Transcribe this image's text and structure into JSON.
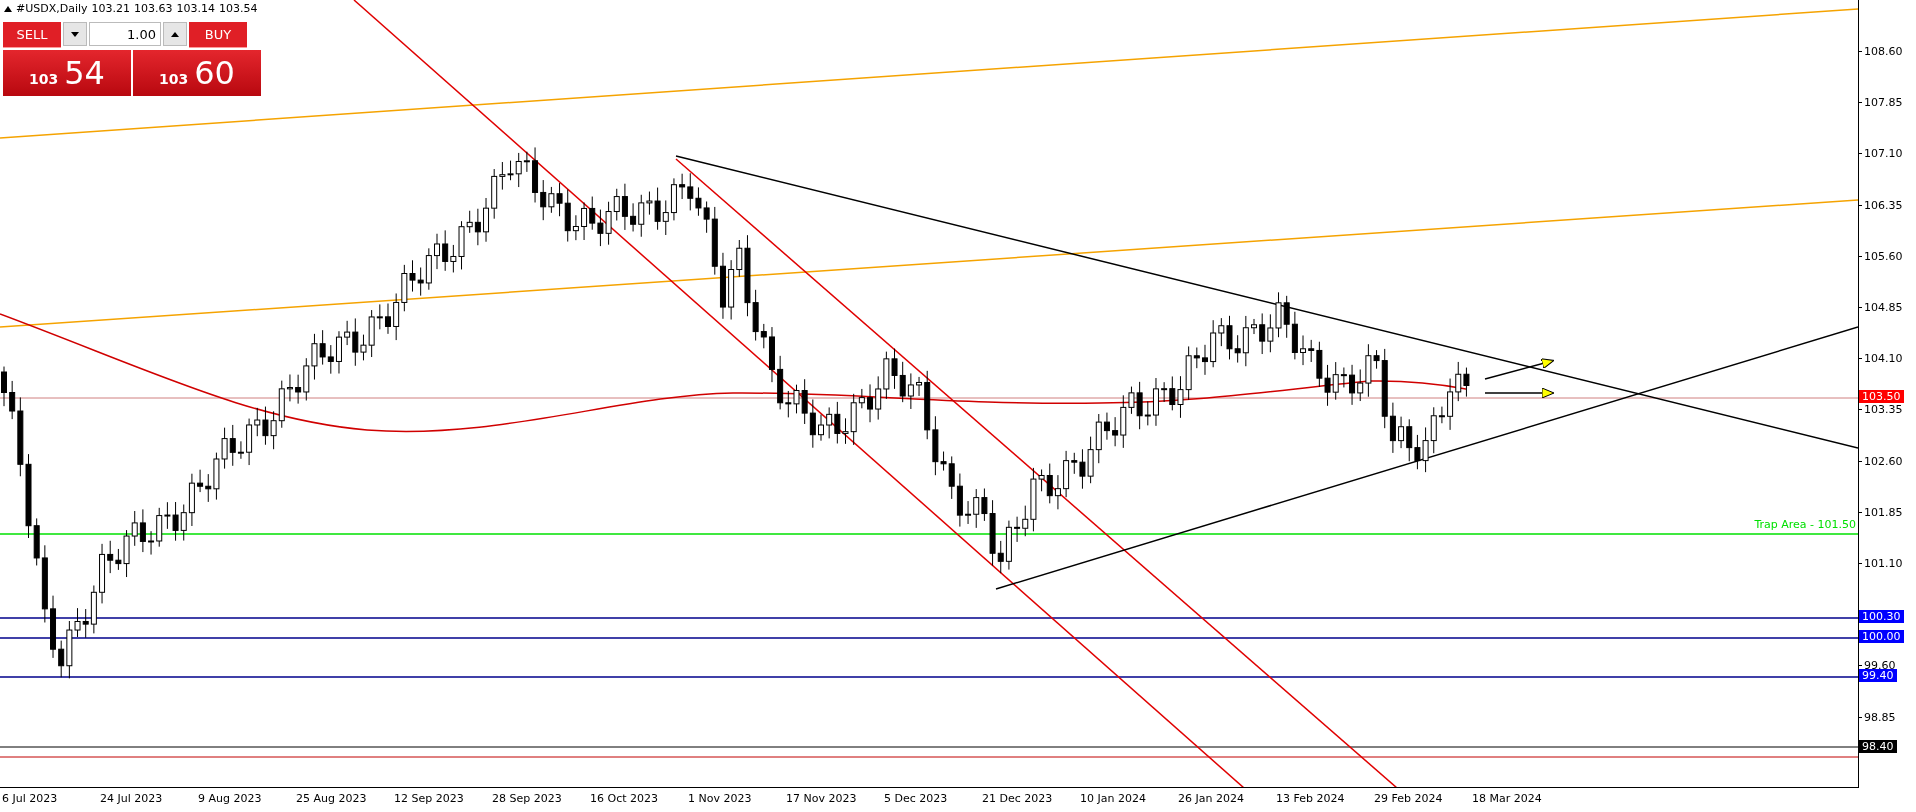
{
  "chart": {
    "symbol": "#USDX,Daily",
    "ohlc": [
      "103.21",
      "103.63",
      "103.14",
      "103.54"
    ]
  },
  "trade_panel": {
    "sell_label": "SELL",
    "buy_label": "BUY",
    "lot": "1.00",
    "sell_price": {
      "handle": "103",
      "pips": "54"
    },
    "buy_price": {
      "handle": "103",
      "pips": "60"
    }
  },
  "trap_line": {
    "label": "Trap Area - 101.50"
  },
  "price_axis": {
    "ticks": [
      "108.60",
      "107.85",
      "107.10",
      "106.35",
      "105.60",
      "104.85",
      "104.10",
      "103.35",
      "102.60",
      "101.85",
      "101.10",
      "99.60",
      "98.85"
    ]
  },
  "price_markers": [
    {
      "text": "103.50",
      "color": "#ff0000"
    },
    {
      "text": "100.30",
      "color": "#0000ff"
    },
    {
      "text": "100.00",
      "color": "#0000ff"
    },
    {
      "text": "99.40",
      "color": "#0000ff"
    },
    {
      "text": "98.40",
      "color": "#000000"
    }
  ],
  "date_axis": [
    "6 Jul 2023",
    "24 Jul 2023",
    "9 Aug 2023",
    "25 Aug 2023",
    "12 Sep 2023",
    "28 Sep 2023",
    "16 Oct 2023",
    "1 Nov 2023",
    "17 Nov 2023",
    "5 Dec 2023",
    "21 Dec 2023",
    "10 Jan 2024",
    "26 Jan 2024",
    "13 Feb 2024",
    "29 Feb 2024",
    "18 Mar 2024"
  ]
}
